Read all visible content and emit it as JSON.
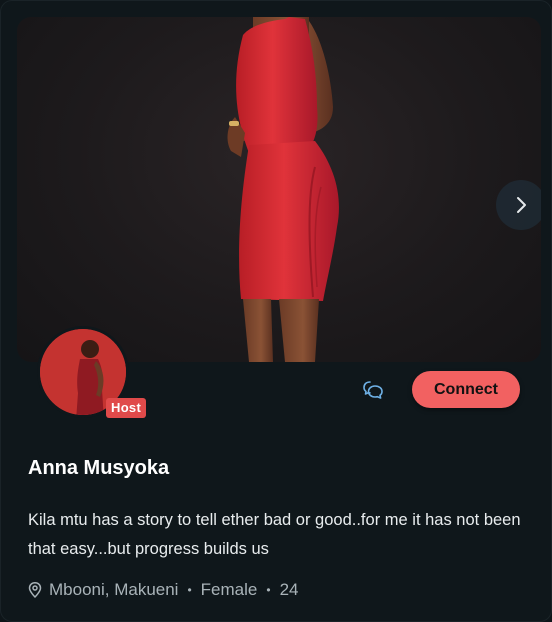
{
  "profile": {
    "name": "Anna Musyoka",
    "badge": "Host",
    "bio": "Kila mtu has a story to tell ether bad or good..for me it has not been that easy...but progress builds us",
    "location": "Mbooni, Makueni",
    "gender": "Female",
    "age": "24",
    "separator": "•"
  },
  "actions": {
    "connect_label": "Connect"
  },
  "icons": {
    "next": "chevron-right-icon",
    "chat": "chat-bubbles-icon",
    "location": "map-pin-icon"
  },
  "colors": {
    "accent": "#f26161",
    "badge": "#e04a4a",
    "card_bg": "#0f171b",
    "dress": "#d42a2f"
  }
}
